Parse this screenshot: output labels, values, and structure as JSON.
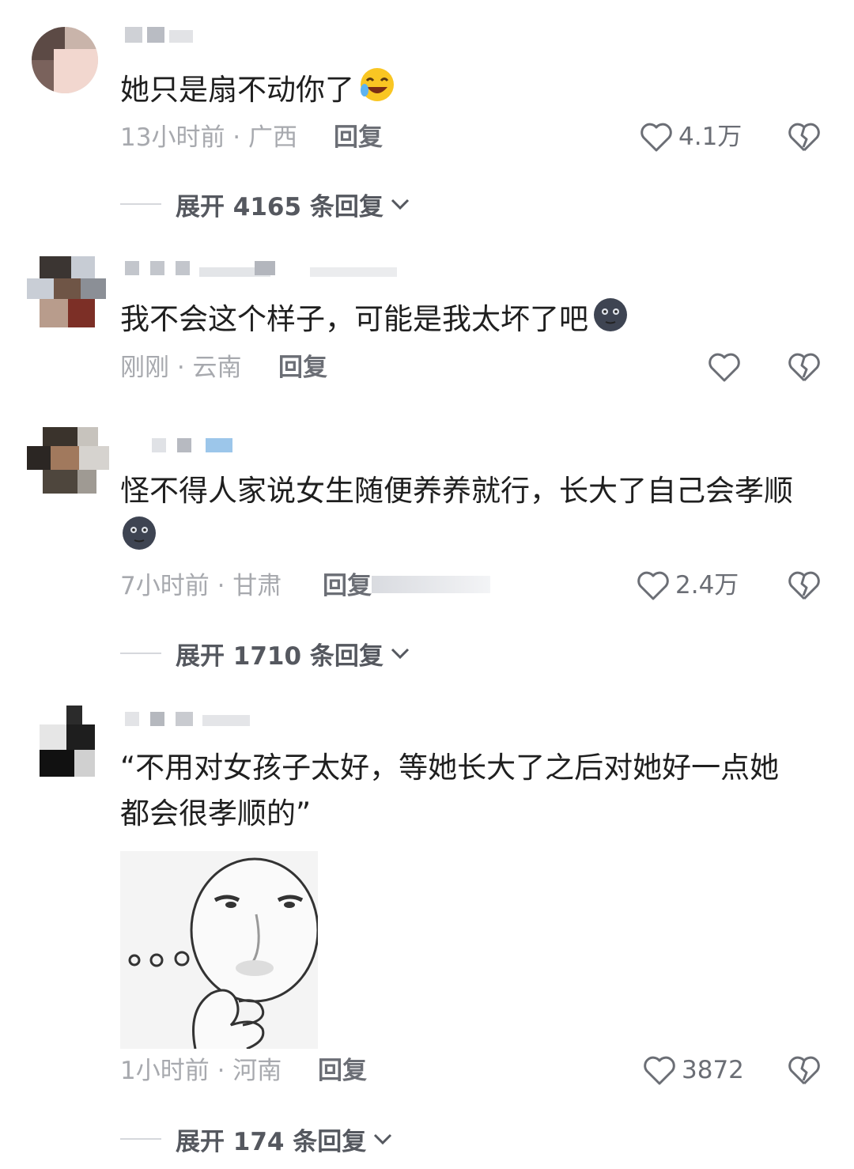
{
  "comments": [
    {
      "text": "她只是扇不动你了",
      "emoji": "rofl-emoji",
      "time_location": "13小时前 · 广西",
      "reply_label": "回复",
      "likes": "4.1万",
      "expand_label": "展开 4165 条回复"
    },
    {
      "text": "我不会这个样子，可能是我太坏了吧",
      "emoji": "dark-moon-emoji",
      "time_location": "刚刚 · 云南",
      "reply_label": "回复",
      "likes": ""
    },
    {
      "text": "怪不得人家说女生随便养养就行，长大了自己会孝顺",
      "emoji": "dark-moon-emoji",
      "time_location": "7小时前 · 甘肃",
      "reply_label": "回复",
      "likes": "2.4万",
      "expand_label": "展开 1710 条回复"
    },
    {
      "text": "“不用对女孩子太好，等她长大了之后对她好一点她都会很孝顺的”",
      "image": "thinking-meme-image",
      "time_location": "1小时前 · 河南",
      "reply_label": "回复",
      "likes": "3872",
      "expand_label": "展开 174 条回复"
    }
  ],
  "colors": {
    "meta": "#a7a9ae",
    "reply": "#6b6e75",
    "text": "#1f1f1f"
  }
}
